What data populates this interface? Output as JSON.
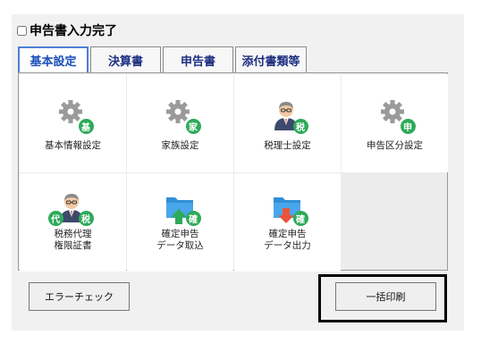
{
  "completion": {
    "checked": false,
    "label": "申告書入力完了"
  },
  "tabs": [
    {
      "label": "基本設定",
      "active": true
    },
    {
      "label": "決算書",
      "active": false
    },
    {
      "label": "申告書",
      "active": false
    },
    {
      "label": "添付書類等",
      "active": false
    }
  ],
  "tiles": {
    "basic_info": {
      "label": "基本情報設定",
      "icon": "gear-icon",
      "badge": "基"
    },
    "family": {
      "label": "家族設定",
      "icon": "gear-icon",
      "badge": "家"
    },
    "tax_accountant": {
      "label": "税理士設定",
      "icon": "person-icon",
      "badge": "税"
    },
    "filing_category": {
      "label": "申告区分設定",
      "icon": "gear-icon",
      "badge": "申"
    },
    "proxy_certificate": {
      "label_line1": "税務代理",
      "label_line2": "権限証書",
      "icon": "person-icon",
      "badge_left": "代",
      "badge_right": "税"
    },
    "data_import": {
      "label_line1": "確定申告",
      "label_line2": "データ取込",
      "icon": "folder-import-icon",
      "badge": "確"
    },
    "data_export": {
      "label_line1": "確定申告",
      "label_line2": "データ出力",
      "icon": "folder-export-icon",
      "badge": "確"
    }
  },
  "buttons": {
    "error_check": "エラーチェック",
    "batch_print": "一括印刷"
  },
  "colors": {
    "badge": "#2eaa5a",
    "gear": "#9a9a9a",
    "folder": "#2e8fd8",
    "arrow_green": "#2eaa5a",
    "arrow_red": "#e8553a",
    "tab_text": "#1d2f80"
  }
}
